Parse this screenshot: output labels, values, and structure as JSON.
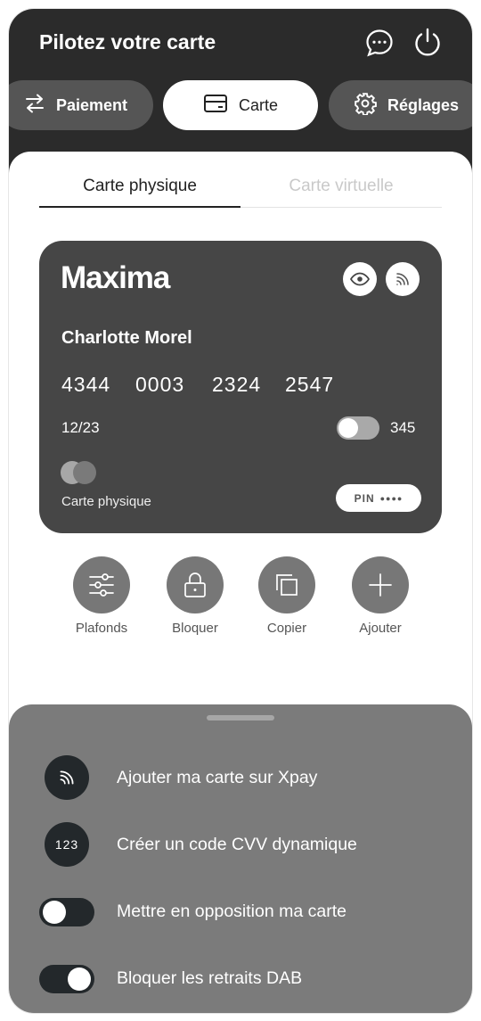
{
  "header": {
    "title": "Pilotez votre carte",
    "icons": [
      "chat-icon",
      "power-icon"
    ]
  },
  "nav": [
    {
      "label": "Paiement",
      "icon": "transfer-arrows-icon",
      "active": false
    },
    {
      "label": "Carte",
      "icon": "card-icon",
      "active": true
    },
    {
      "label": "Réglages",
      "icon": "gear-icon",
      "active": false
    }
  ],
  "tabs": {
    "physical": "Carte physique",
    "virtual": "Carte virtuelle",
    "selected": "physical"
  },
  "card": {
    "brand": "Maxima",
    "holder": "Charlotte Morel",
    "number": [
      "4344",
      "0003",
      "2324",
      "2547"
    ],
    "expiry": "12/23",
    "cvv": "345",
    "cvv_toggle_on": false,
    "type_label": "Carte physique",
    "pin_label": "PIN",
    "pin_mask": "●●●●",
    "icons": [
      "eye-icon",
      "contactless-icon"
    ]
  },
  "actions": [
    {
      "label": "Plafonds",
      "icon": "sliders-icon"
    },
    {
      "label": "Bloquer",
      "icon": "lock-icon"
    },
    {
      "label": "Copier",
      "icon": "copy-icon"
    },
    {
      "label": "Ajouter",
      "icon": "plus-icon"
    }
  ],
  "sheet": {
    "items": [
      {
        "label": "Ajouter ma carte sur Xpay",
        "icon": "contactless-icon"
      },
      {
        "label": "Créer un code CVV dynamique",
        "icon_text": "123"
      },
      {
        "label": "Mettre en opposition ma carte",
        "toggle_on": false
      },
      {
        "label": "Bloquer les retraits DAB",
        "toggle_on": true
      }
    ]
  },
  "colors": {
    "header_bg": "#2b2b2b",
    "card_bg": "#464646",
    "action_circle": "#777777",
    "sheet_bg": "#7b7b7b",
    "icon_dark": "#23282b"
  }
}
